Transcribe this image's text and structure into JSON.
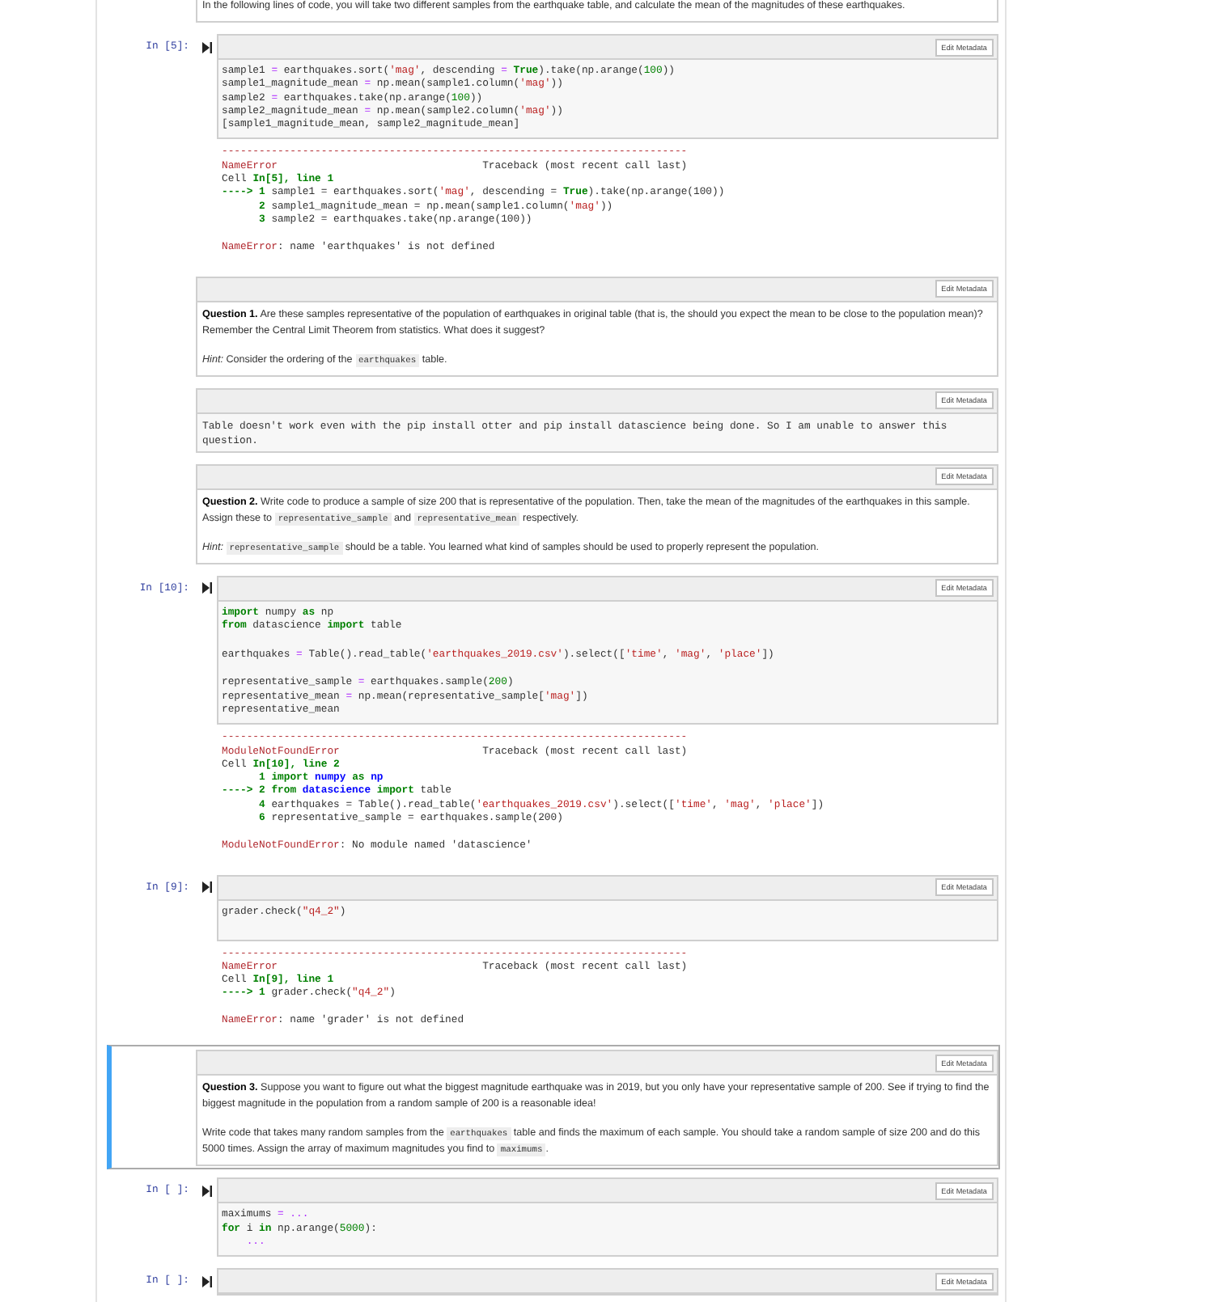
{
  "cells": [
    {
      "kind": "markdown",
      "selected": false,
      "paragraphs": [
        [
          "In the following lines of code, you will take two different samples from the earthquake table, and calculate the mean of the magnitudes of these earthquakes."
        ]
      ]
    },
    {
      "kind": "code",
      "selected": false,
      "prompt": "In [5]:",
      "edit_button": "Edit Metadata",
      "code": [
        {
          "tokens": [
            "sample1 ",
            {
              "kind": "operator",
              "text": "="
            },
            " earthquakes.sort(",
            {
              "kind": "string",
              "text": "'mag'"
            },
            ", descending ",
            {
              "kind": "operator",
              "text": "= "
            },
            {
              "kind": "keyword",
              "text": "True"
            },
            ").take(np.arange(",
            {
              "kind": "number",
              "text": "100"
            },
            "))"
          ]
        },
        {
          "tokens": [
            "sample1_magnitude_mean ",
            {
              "kind": "operator",
              "text": "="
            },
            " np.mean(sample1.column(",
            {
              "kind": "string",
              "text": "'mag'"
            },
            "))"
          ]
        },
        {
          "tokens": [
            "sample2 ",
            {
              "kind": "operator",
              "text": "="
            },
            " earthquakes.take(np.arange(",
            {
              "kind": "number",
              "text": "100"
            },
            "))"
          ]
        },
        {
          "tokens": [
            "sample2_magnitude_mean ",
            {
              "kind": "operator",
              "text": "="
            },
            " np.mean(sample2.column(",
            {
              "kind": "string",
              "text": "'mag'"
            },
            "))"
          ]
        },
        {
          "tokens": [
            "[sample1_magnitude_mean, sample2_magnitude_mean]"
          ]
        }
      ],
      "output": [
        {
          "tokens": [
            {
              "kind": "error",
              "text": "---------------------------------------------------------------------------"
            }
          ]
        },
        {
          "tokens": [
            {
              "kind": "error",
              "text": "NameError"
            },
            "                                 Traceback (most recent call last)"
          ]
        },
        {
          "tokens": [
            "Cell ",
            {
              "kind": "cellref",
              "text": "In[5], line 1"
            }
          ]
        },
        {
          "tokens": [
            {
              "kind": "lineno",
              "text": "----> 1 "
            },
            "sample1 = earthquakes.sort(",
            {
              "kind": "string",
              "text": "'mag'"
            },
            ", descending = ",
            {
              "kind": "keyword",
              "text": "True"
            },
            ").take(np.arange(100))"
          ]
        },
        {
          "tokens": [
            {
              "kind": "lineno",
              "text": "      2 "
            },
            "sample1_magnitude_mean = np.mean(sample1.column(",
            {
              "kind": "string",
              "text": "'mag'"
            },
            "))"
          ]
        },
        {
          "tokens": [
            {
              "kind": "lineno",
              "text": "      3 "
            },
            "sample2 = earthquakes.take(np.arange(100))"
          ]
        },
        {
          "blank_before": true,
          "tokens": [
            {
              "kind": "error",
              "text": "NameError"
            },
            ": name 'earthquakes' is not defined"
          ]
        }
      ]
    },
    {
      "kind": "markdown",
      "selected": false,
      "edit_button": "Edit Metadata",
      "paragraphs": [
        [
          "**Question 1.** Are these samples representative of the population of earthquakes in original table (that is, the should you expect the mean to be close to the population mean)? Remember the Central Limit Theorem from statistics. What does it suggest?"
        ],
        [
          "*Hint:* Consider the ordering of the ",
          {
            "kind": "code",
            "text": "earthquakes"
          },
          " table."
        ]
      ]
    },
    {
      "kind": "raw",
      "selected": false,
      "edit_button": "Edit Metadata",
      "text": "Table doesn't work even with the pip install otter and pip install datascience being done. So I am unable to answer this question."
    },
    {
      "kind": "markdown",
      "selected": false,
      "edit_button": "Edit Metadata",
      "paragraphs": [
        [
          "**Question 2.** Write code to produce a sample of size 200 that is representative of the population. Then, take the mean of the magnitudes of the earthquakes in this sample. Assign these to ",
          {
            "kind": "code",
            "text": "representative_sample"
          },
          " and ",
          {
            "kind": "code",
            "text": "representative_mean"
          },
          " respectively."
        ],
        [
          "*Hint:* ",
          {
            "kind": "code",
            "text": "representative_sample"
          },
          " should be a table. You learned what kind of samples should be used to properly represent the population."
        ]
      ]
    },
    {
      "kind": "code",
      "selected": false,
      "prompt": "In [10]:",
      "edit_button": "Edit Metadata",
      "code": [
        {
          "tokens": [
            {
              "kind": "keyword",
              "text": "import"
            },
            " numpy ",
            {
              "kind": "keyword",
              "text": "as"
            },
            " np"
          ]
        },
        {
          "tokens": [
            {
              "kind": "keyword",
              "text": "from"
            },
            " datascience ",
            {
              "kind": "keyword",
              "text": "import"
            },
            " table"
          ]
        },
        {
          "blank_before": true,
          "tokens": [
            "earthquakes ",
            {
              "kind": "operator",
              "text": "="
            },
            " Table().read_table(",
            {
              "kind": "string",
              "text": "'earthquakes_2019.csv'"
            },
            ").select([",
            {
              "kind": "string",
              "text": "'time'"
            },
            ", ",
            {
              "kind": "string",
              "text": "'mag'"
            },
            ", ",
            {
              "kind": "string",
              "text": "'place'"
            },
            "])"
          ]
        },
        {
          "blank_before": true,
          "tokens": [
            "representative_sample ",
            {
              "kind": "operator",
              "text": "="
            },
            " earthquakes.sample(",
            {
              "kind": "number",
              "text": "200"
            },
            ")"
          ]
        },
        {
          "tokens": [
            "representative_mean ",
            {
              "kind": "operator",
              "text": "="
            },
            " np.mean(representative_sample[",
            {
              "kind": "string",
              "text": "'mag'"
            },
            "])"
          ]
        },
        {
          "tokens": [
            "representative_mean"
          ]
        }
      ],
      "output": [
        {
          "tokens": [
            {
              "kind": "error",
              "text": "---------------------------------------------------------------------------"
            }
          ]
        },
        {
          "tokens": [
            {
              "kind": "error",
              "text": "ModuleNotFoundError"
            },
            "                       Traceback (most recent call last)"
          ]
        },
        {
          "tokens": [
            "Cell ",
            {
              "kind": "cellref",
              "text": "In[10], line 2"
            }
          ]
        },
        {
          "tokens": [
            {
              "kind": "lineno",
              "text": "      1 "
            },
            {
              "kind": "keyword",
              "text": "import "
            },
            {
              "kind": "module",
              "text": "numpy "
            },
            {
              "kind": "keyword",
              "text": "as "
            },
            {
              "kind": "module",
              "text": "np"
            }
          ]
        },
        {
          "tokens": [
            {
              "kind": "lineno",
              "text": "----> 2 "
            },
            {
              "kind": "keyword",
              "text": "from "
            },
            {
              "kind": "module",
              "text": "datascience "
            },
            {
              "kind": "keyword",
              "text": "import"
            },
            " table"
          ]
        },
        {
          "tokens": [
            {
              "kind": "lineno",
              "text": "      4 "
            },
            "earthquakes = Table().read_table(",
            {
              "kind": "string",
              "text": "'earthquakes_2019.csv'"
            },
            ").select([",
            {
              "kind": "string",
              "text": "'time'"
            },
            ", ",
            {
              "kind": "string",
              "text": "'mag'"
            },
            ", ",
            {
              "kind": "string",
              "text": "'place'"
            },
            "])"
          ]
        },
        {
          "tokens": [
            {
              "kind": "lineno",
              "text": "      6 "
            },
            "representative_sample = earthquakes.sample(200)"
          ]
        },
        {
          "blank_before": true,
          "tokens": [
            {
              "kind": "error",
              "text": "ModuleNotFoundError"
            },
            ": No module named 'datascience'"
          ]
        }
      ]
    },
    {
      "kind": "code",
      "selected": false,
      "prompt": "In [9]:",
      "edit_button": "Edit Metadata",
      "code": [
        {
          "tokens": [
            "grader.check(",
            {
              "kind": "string",
              "text": "\"q4_2\""
            },
            ")"
          ]
        }
      ],
      "output": [
        {
          "tokens": [
            {
              "kind": "error",
              "text": "---------------------------------------------------------------------------"
            }
          ]
        },
        {
          "tokens": [
            {
              "kind": "error",
              "text": "NameError"
            },
            "                                 Traceback (most recent call last)"
          ]
        },
        {
          "tokens": [
            "Cell ",
            {
              "kind": "cellref",
              "text": "In[9], line 1"
            }
          ]
        },
        {
          "tokens": [
            {
              "kind": "lineno",
              "text": "----> 1 "
            },
            "grader.check(",
            {
              "kind": "string",
              "text": "\"q4_2\""
            },
            ")"
          ]
        },
        {
          "blank_before": true,
          "tokens": [
            {
              "kind": "error",
              "text": "NameError"
            },
            ": name 'grader' is not defined"
          ]
        }
      ]
    },
    {
      "kind": "markdown",
      "selected": true,
      "edit_button": "Edit Metadata",
      "paragraphs": [
        [
          "**Question 3.** Suppose you want to figure out what the biggest magnitude earthquake was in 2019, but you only have your representative sample of 200. See if trying to find the biggest magnitude in the population from a random sample of 200 is a reasonable idea!"
        ],
        [
          "Write code that takes many random samples from the ",
          {
            "kind": "code",
            "text": "earthquakes"
          },
          " table and finds the maximum of each sample. You should take a random sample of size 200 and do this 5000 times. Assign the array of maximum magnitudes you find to ",
          {
            "kind": "code",
            "text": "maximums"
          },
          "."
        ]
      ]
    },
    {
      "kind": "code",
      "selected": false,
      "prompt": "In [ ]:",
      "edit_button": "Edit Metadata",
      "code": [
        {
          "tokens": [
            "maximums ",
            {
              "kind": "operator",
              "text": "= ..."
            }
          ]
        },
        {
          "tokens": [
            {
              "kind": "keyword",
              "text": "for"
            },
            " i ",
            {
              "kind": "keyword",
              "text": "in"
            },
            " np.arange(",
            {
              "kind": "number",
              "text": "5000"
            },
            "):"
          ]
        },
        {
          "tokens": [
            {
              "kind": "operator",
              "text": "    ..."
            }
          ]
        }
      ]
    },
    {
      "kind": "code",
      "selected": false,
      "prompt": "In [ ]:",
      "edit_button": "Edit Metadata"
    }
  ]
}
